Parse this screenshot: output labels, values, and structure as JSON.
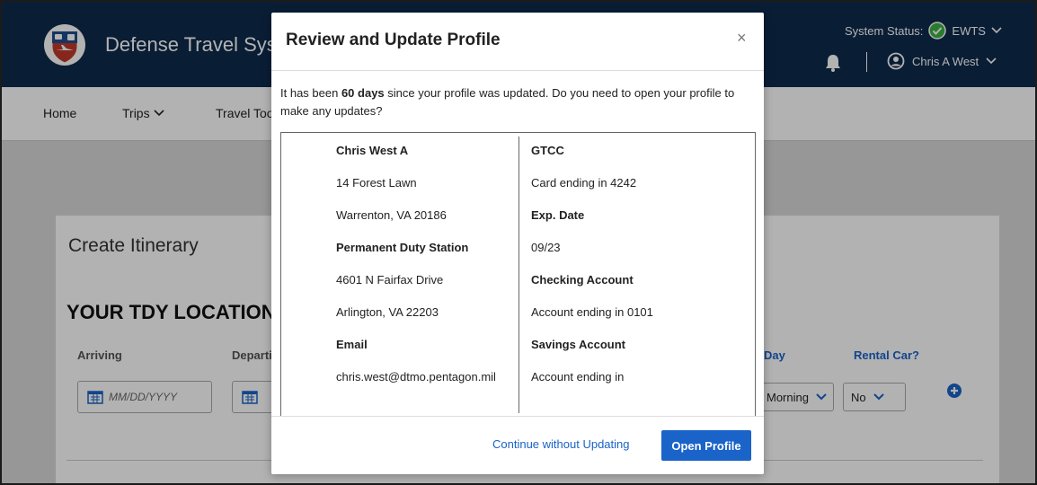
{
  "header": {
    "app_title": "Defense Travel System",
    "system_status_label": "System Status:",
    "system_status_name": "EWTS",
    "user_name": "Chris A West"
  },
  "nav": {
    "items": [
      {
        "label": "Home"
      },
      {
        "label": "Trips"
      },
      {
        "label": "Travel Tools"
      }
    ]
  },
  "page": {
    "card_title": "Create Itinerary",
    "section_title": "YOUR TDY LOCATIONS",
    "arriving_label": "Arriving",
    "departing_label": "Departing",
    "date_placeholder": "MM/DD/YYYY",
    "day_label": "Day",
    "rental_car_label": "Rental Car?",
    "time_of_day_value": "Morning",
    "rental_car_value": "No"
  },
  "modal": {
    "title": "Review and Update Profile",
    "close_symbol": "×",
    "message_prefix": "It has been ",
    "message_days": "60 days",
    "message_suffix": " since your profile was updated. Do you need to open your profile to make any updates?",
    "left_column": [
      {
        "text": "Chris West A",
        "bold": true
      },
      {
        "text": "14 Forest Lawn",
        "bold": false
      },
      {
        "text": "Warrenton, VA 20186",
        "bold": false
      },
      {
        "text": "Permanent Duty Station",
        "bold": true
      },
      {
        "text": "4601 N Fairfax Drive",
        "bold": false
      },
      {
        "text": "Arlington, VA 22203",
        "bold": false
      },
      {
        "text": "Email",
        "bold": true
      },
      {
        "text": "chris.west@dtmo.pentagon.mil",
        "bold": false
      }
    ],
    "right_column": [
      {
        "text": "GTCC",
        "bold": true
      },
      {
        "text": "Card ending in 4242",
        "bold": false
      },
      {
        "text": "Exp. Date",
        "bold": true
      },
      {
        "text": "09/23",
        "bold": false
      },
      {
        "text": "Checking Account",
        "bold": true
      },
      {
        "text": "Account ending in 0101",
        "bold": false
      },
      {
        "text": "Savings Account",
        "bold": true
      },
      {
        "text": "Account ending in",
        "bold": false
      }
    ],
    "continue_label": "Continue without Updating",
    "open_profile_label": "Open Profile"
  },
  "colors": {
    "header_bg": "#0e2a4c",
    "primary": "#1a63c8",
    "status_ok": "#3cb043"
  },
  "icons": [
    "shield-logo-icon",
    "check-circle-icon",
    "bell-icon",
    "user-circle-icon",
    "chevron-down-icon",
    "calendar-icon",
    "plus-circle-icon",
    "close-icon"
  ]
}
